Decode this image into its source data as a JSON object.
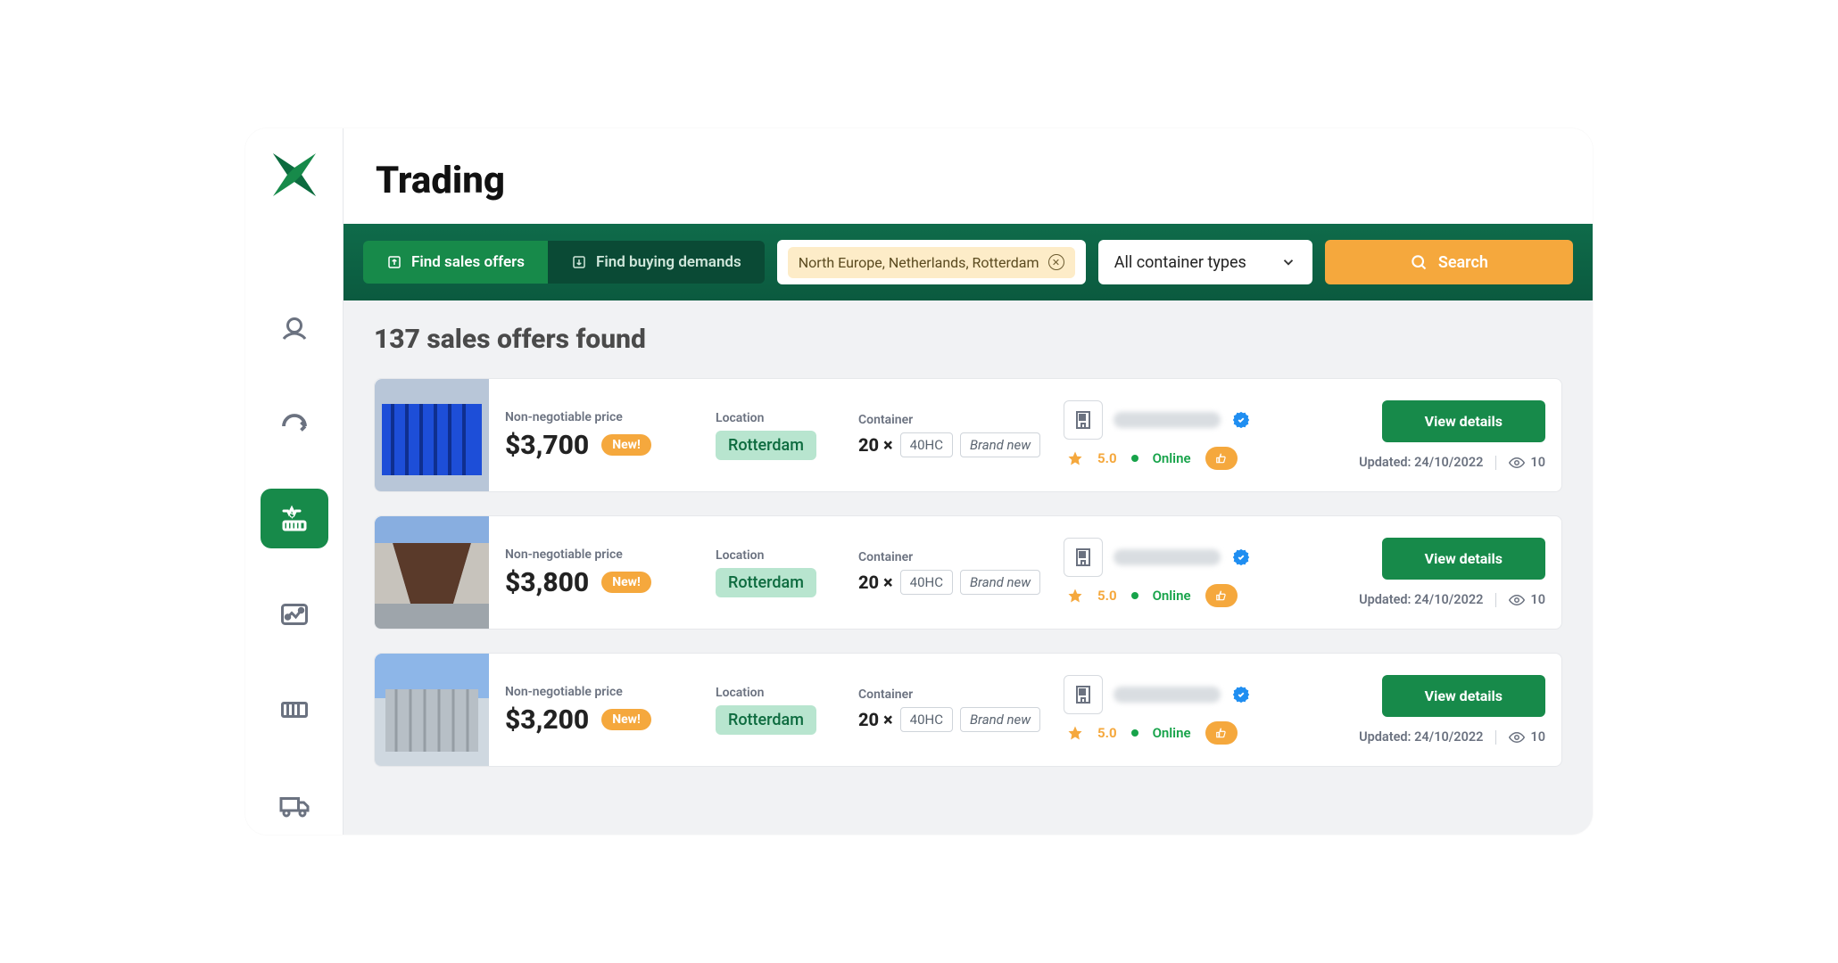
{
  "page": {
    "title": "Trading"
  },
  "filterBar": {
    "findSales": "Find sales offers",
    "findBuying": "Find buying demands",
    "locationChip": "North Europe, Netherlands, Rotterdam",
    "containerType": "All container types",
    "searchLabel": "Search"
  },
  "results": {
    "heading": "137 sales offers found"
  },
  "offers": [
    {
      "priceLabel": "Non-negotiable price",
      "price": "$3,700",
      "badge": "New!",
      "locLabel": "Location",
      "location": "Rotterdam",
      "contLabel": "Container",
      "qty": "20 ×",
      "type": "40HC",
      "condition": "Brand new",
      "rating": "5.0",
      "status": "Online",
      "view": "View details",
      "updated": "Updated: 24/10/2022",
      "views": "10",
      "imgColor": "blue"
    },
    {
      "priceLabel": "Non-negotiable price",
      "price": "$3,800",
      "badge": "New!",
      "locLabel": "Location",
      "location": "Rotterdam",
      "contLabel": "Container",
      "qty": "20 ×",
      "type": "40HC",
      "condition": "Brand new",
      "rating": "5.0",
      "status": "Online",
      "view": "View details",
      "updated": "Updated: 24/10/2022",
      "views": "10",
      "imgColor": "open"
    },
    {
      "priceLabel": "Non-negotiable price",
      "price": "$3,200",
      "badge": "New!",
      "locLabel": "Location",
      "location": "Rotterdam",
      "contLabel": "Container",
      "qty": "20 ×",
      "type": "40HC",
      "condition": "Brand new",
      "rating": "5.0",
      "status": "Online",
      "view": "View details",
      "updated": "Updated: 24/10/2022",
      "views": "10",
      "imgColor": "grey"
    }
  ]
}
